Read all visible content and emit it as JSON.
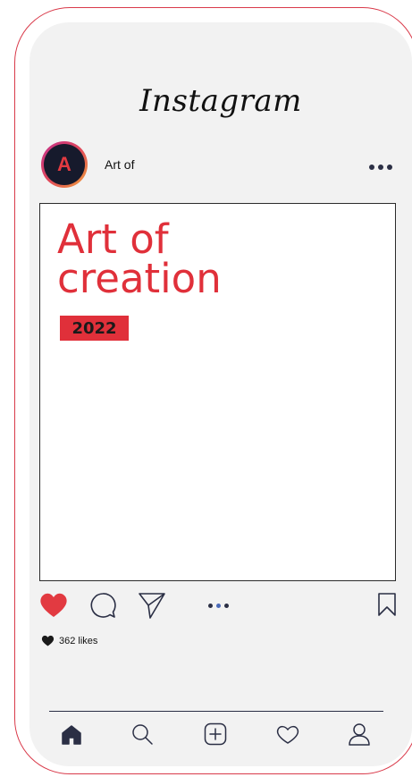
{
  "app": {
    "title": "Instagram"
  },
  "post": {
    "username": "Art of",
    "avatar_letter": "A",
    "title_line1": "Art of",
    "title_line2": "creation",
    "badge": "2022",
    "likes": "362 likes",
    "carousel_total": 3,
    "carousel_active": 2
  },
  "icons": {
    "like": "heart-filled-icon",
    "comment": "comment-bubble-icon",
    "share": "paper-plane-icon",
    "save": "bookmark-icon",
    "more": "more-horizontal-icon"
  },
  "bottom_nav": [
    "home-icon",
    "search-icon",
    "add-post-icon",
    "activity-heart-icon",
    "profile-icon"
  ],
  "colors": {
    "brand_red": "#e0303a",
    "frame": "#d93a4a",
    "navy": "#2b2f45",
    "like_red": "#e23a41"
  }
}
